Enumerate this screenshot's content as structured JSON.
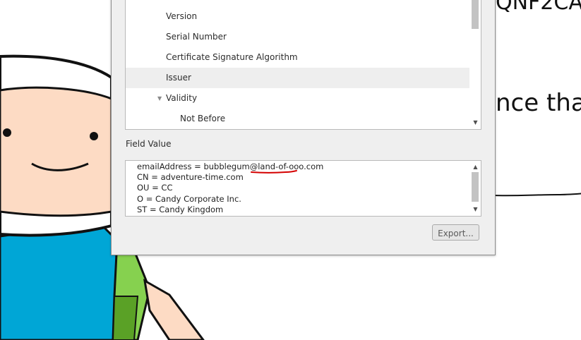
{
  "background": {
    "top_text": "QNF2CA",
    "mid_text": "nce that"
  },
  "dialog": {
    "tree": {
      "items": [
        {
          "label": "Version",
          "expanded": null,
          "selected": false
        },
        {
          "label": "Serial Number",
          "expanded": null,
          "selected": false
        },
        {
          "label": "Certificate Signature Algorithm",
          "expanded": null,
          "selected": false
        },
        {
          "label": "Issuer",
          "expanded": null,
          "selected": true
        },
        {
          "label": "Validity",
          "expanded": true,
          "selected": false
        },
        {
          "label": "Not Before",
          "expanded": null,
          "selected": false
        }
      ],
      "expanded_icon": "triangle-down-icon"
    },
    "field_value_label": "Field Value",
    "field_value_lines": [
      "emailAddress = bubblegum@land-of-ooo.com",
      "CN = adventure-time.com",
      "OU = CC",
      "O = Candy Corporate Inc.",
      "ST = Candy Kingdom"
    ],
    "export_label": "Export...",
    "annotation_color": "#d40000"
  }
}
